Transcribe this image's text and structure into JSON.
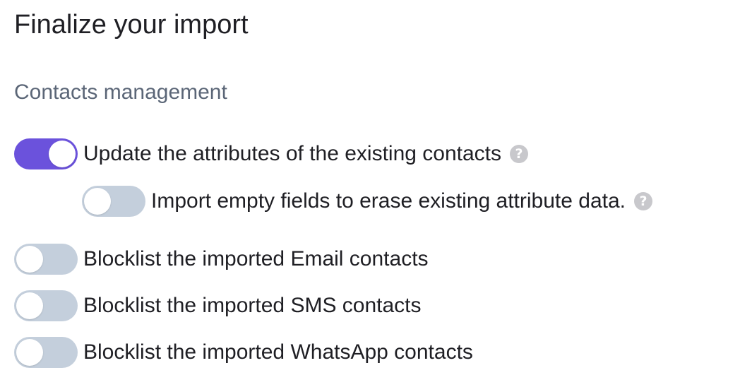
{
  "page": {
    "title": "Finalize your import"
  },
  "section": {
    "title": "Contacts management"
  },
  "options": [
    {
      "label": "Update the attributes of the existing contacts",
      "enabled": true,
      "has_help": true
    },
    {
      "label": "Import empty fields to erase existing attribute data.",
      "enabled": false,
      "has_help": true
    },
    {
      "label": "Blocklist the imported Email contacts",
      "enabled": false,
      "has_help": false
    },
    {
      "label": "Blocklist the imported SMS contacts",
      "enabled": false,
      "has_help": false
    },
    {
      "label": "Blocklist the imported WhatsApp contacts",
      "enabled": false,
      "has_help": false
    }
  ],
  "icons": {
    "help": "question-circle-icon",
    "help_glyph": "?"
  },
  "colors": {
    "toggle_on": "#6b52dc",
    "toggle_off": "#c4cfdc",
    "section_title": "#5b6677",
    "help_icon": "#c8c8cc"
  }
}
